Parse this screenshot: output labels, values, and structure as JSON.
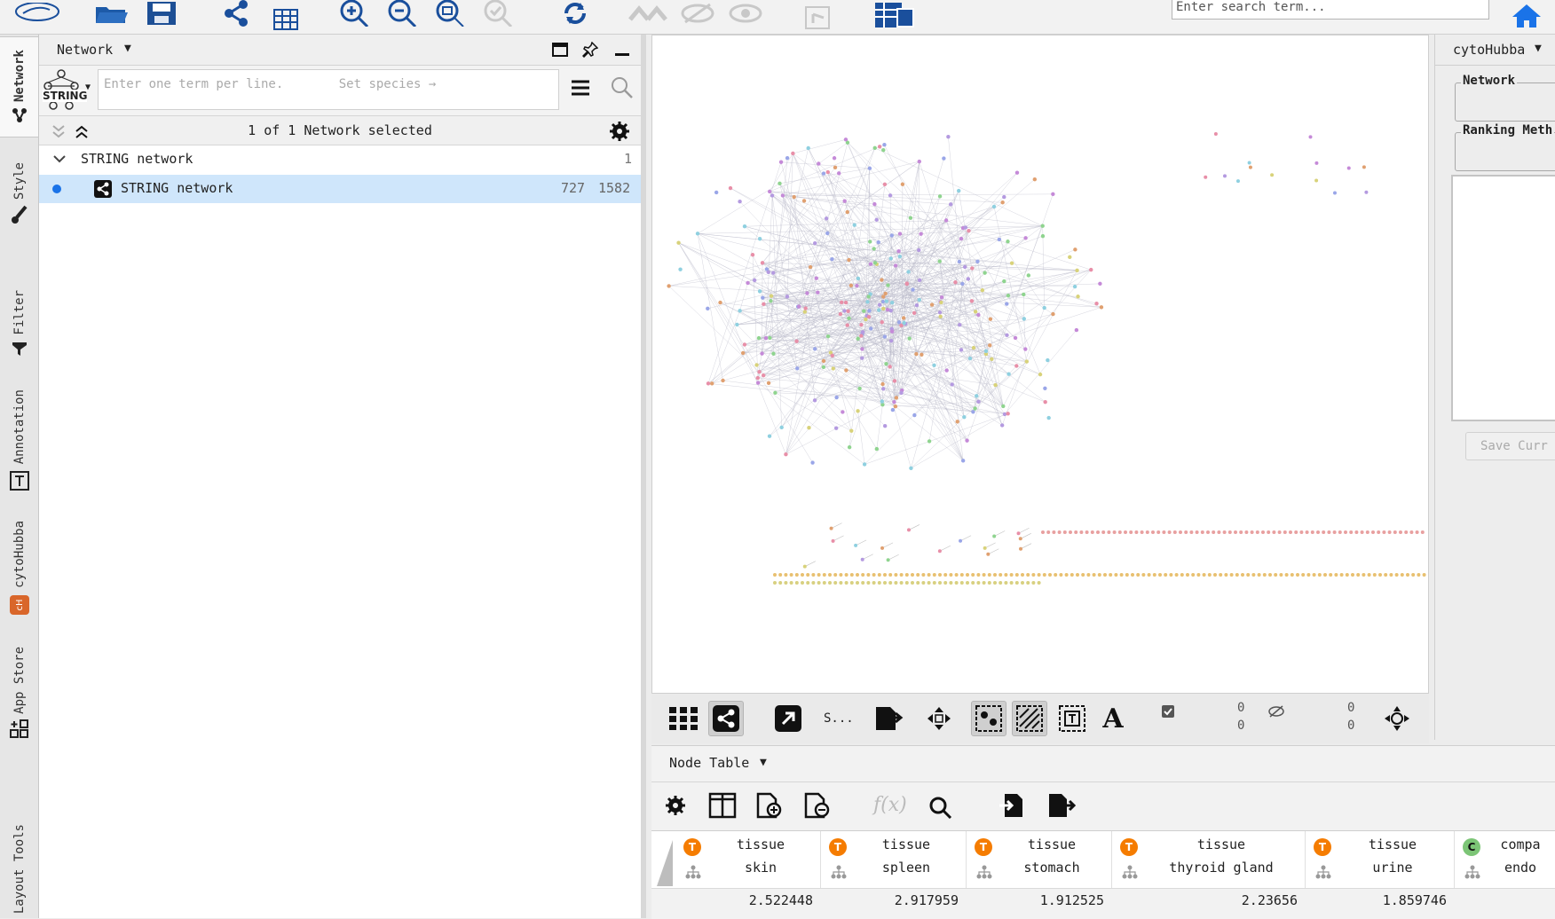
{
  "search": {
    "placeholder": "Enter search term..."
  },
  "vtabs": [
    "Network",
    "Style",
    "Filter",
    "Annotation",
    "cytoHubba",
    "App Store",
    "Layout Tools"
  ],
  "network_panel": {
    "title": "Network",
    "query_placeholder": "Enter one term per line.",
    "species_placeholder": "Set species →",
    "string_logo": "STRING",
    "selection_status": "1 of 1 Network selected",
    "collection": {
      "name": "STRING network",
      "count": "1"
    },
    "network": {
      "name": "STRING network",
      "nodes": "727",
      "edges": "1582"
    }
  },
  "view_toolbar": {
    "s_label": "S...",
    "selected_nodes": "0",
    "selected_edges": "0",
    "hidden_nodes": "0",
    "hidden_edges": "0"
  },
  "right_panel": {
    "title": "cytoHubba",
    "network_label": "Network",
    "ranking_label": "Ranking Meth",
    "save_button": "Save Curr"
  },
  "table_panel": {
    "title": "Node Table",
    "fx_label": "f(x)",
    "columns": [
      {
        "type": "T",
        "l1": "tissue",
        "l2": "skin",
        "value": "2.522448"
      },
      {
        "type": "T",
        "l1": "tissue",
        "l2": "spleen",
        "value": "2.917959"
      },
      {
        "type": "T",
        "l1": "tissue",
        "l2": "stomach",
        "value": "1.912525"
      },
      {
        "type": "T",
        "l1": "tissue",
        "l2": "thyroid gland",
        "value": "2.23656"
      },
      {
        "type": "T",
        "l1": "tissue",
        "l2": "urine",
        "value": "1.859746"
      },
      {
        "type": "C",
        "l1": "compa",
        "l2": "endo",
        "value": ""
      }
    ]
  },
  "colors": {
    "accent": "#1a73e8",
    "badge_T": "#f57c00",
    "badge_C": "#7cc576",
    "selected_row": "#cfe6fb"
  }
}
